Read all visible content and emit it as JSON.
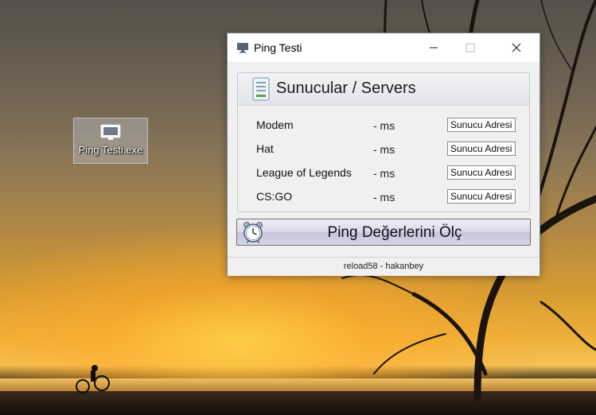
{
  "desktop": {
    "icon_label": "Ping Testi.exe"
  },
  "window": {
    "title": "Ping Testi",
    "controls": {
      "minimize": "—",
      "maximize": "☐",
      "close": "✕"
    }
  },
  "servers": {
    "heading": "Sunucular / Servers",
    "rows": [
      {
        "name": "Modem",
        "ping": "- ms",
        "address": "Sunucu Adresi"
      },
      {
        "name": "Hat",
        "ping": "- ms",
        "address": "Sunucu Adresi"
      },
      {
        "name": "League of Legends",
        "ping": "- ms",
        "address": "Sunucu Adresi"
      },
      {
        "name": "CS:GO",
        "ping": "- ms",
        "address": "Sunucu Adresi"
      }
    ]
  },
  "actions": {
    "measure_label": "Ping Değerlerini Ölç"
  },
  "status": {
    "credit": "reload58 - hakanbey"
  },
  "icons": {
    "desktop": "monitor-icon",
    "app": "monitor-icon",
    "servers": "document-icon",
    "measure": "stopwatch-icon"
  }
}
